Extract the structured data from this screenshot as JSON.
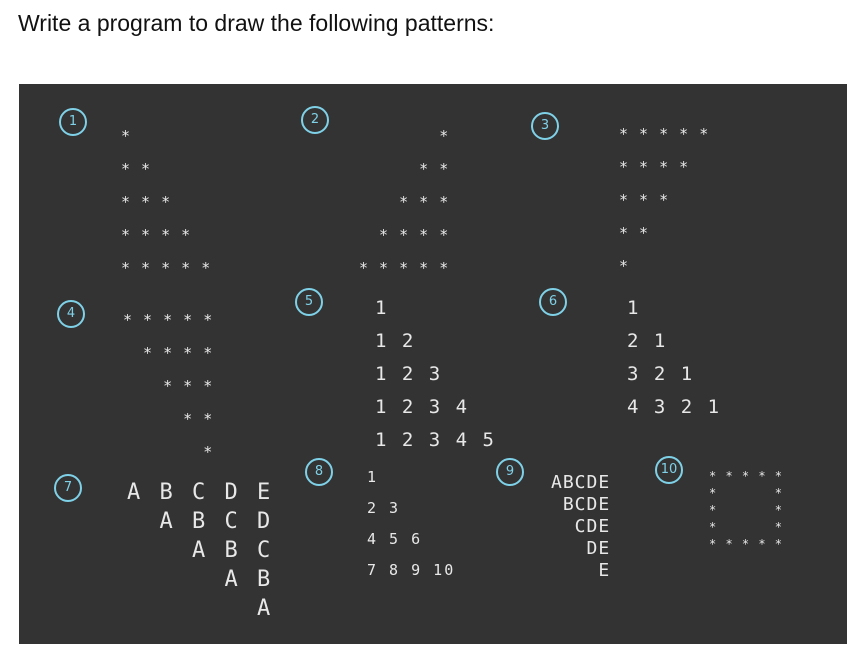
{
  "heading": "Write a program to draw the following patterns:",
  "board_color": "#333333",
  "badge_color": "#7fd1e8",
  "patterns": {
    "p1": {
      "label": "1",
      "text": "*\n* *\n* * *\n* * * *\n* * * * *"
    },
    "p2": {
      "label": "2",
      "text": "        *\n      * *\n    * * *\n  * * * *\n* * * * *"
    },
    "p3": {
      "label": "3",
      "text": "* * * * *\n* * * *\n* * *\n* *\n*"
    },
    "p4": {
      "label": "4",
      "text": "* * * * *\n  * * * *\n    * * *\n      * *\n        *"
    },
    "p5": {
      "label": "5",
      "text": "1\n1 2\n1 2 3\n1 2 3 4\n1 2 3 4 5"
    },
    "p6": {
      "label": "6",
      "text": "1\n2 1\n3 2 1\n4 3 2 1"
    },
    "p7": {
      "label": "7",
      "text": "A B C D E\n  A B C D\n    A B C\n      A B\n        A"
    },
    "p8": {
      "label": "8",
      "text": "1\n2 3\n4 5 6\n7 8 9 10"
    },
    "p9": {
      "label": "9",
      "text": "ABCDE\n BCDE\n  CDE\n   DE\n    E"
    },
    "p10": {
      "label": "10",
      "text": "* * * * *\n*       *\n*       *\n*       *\n* * * * *"
    }
  }
}
